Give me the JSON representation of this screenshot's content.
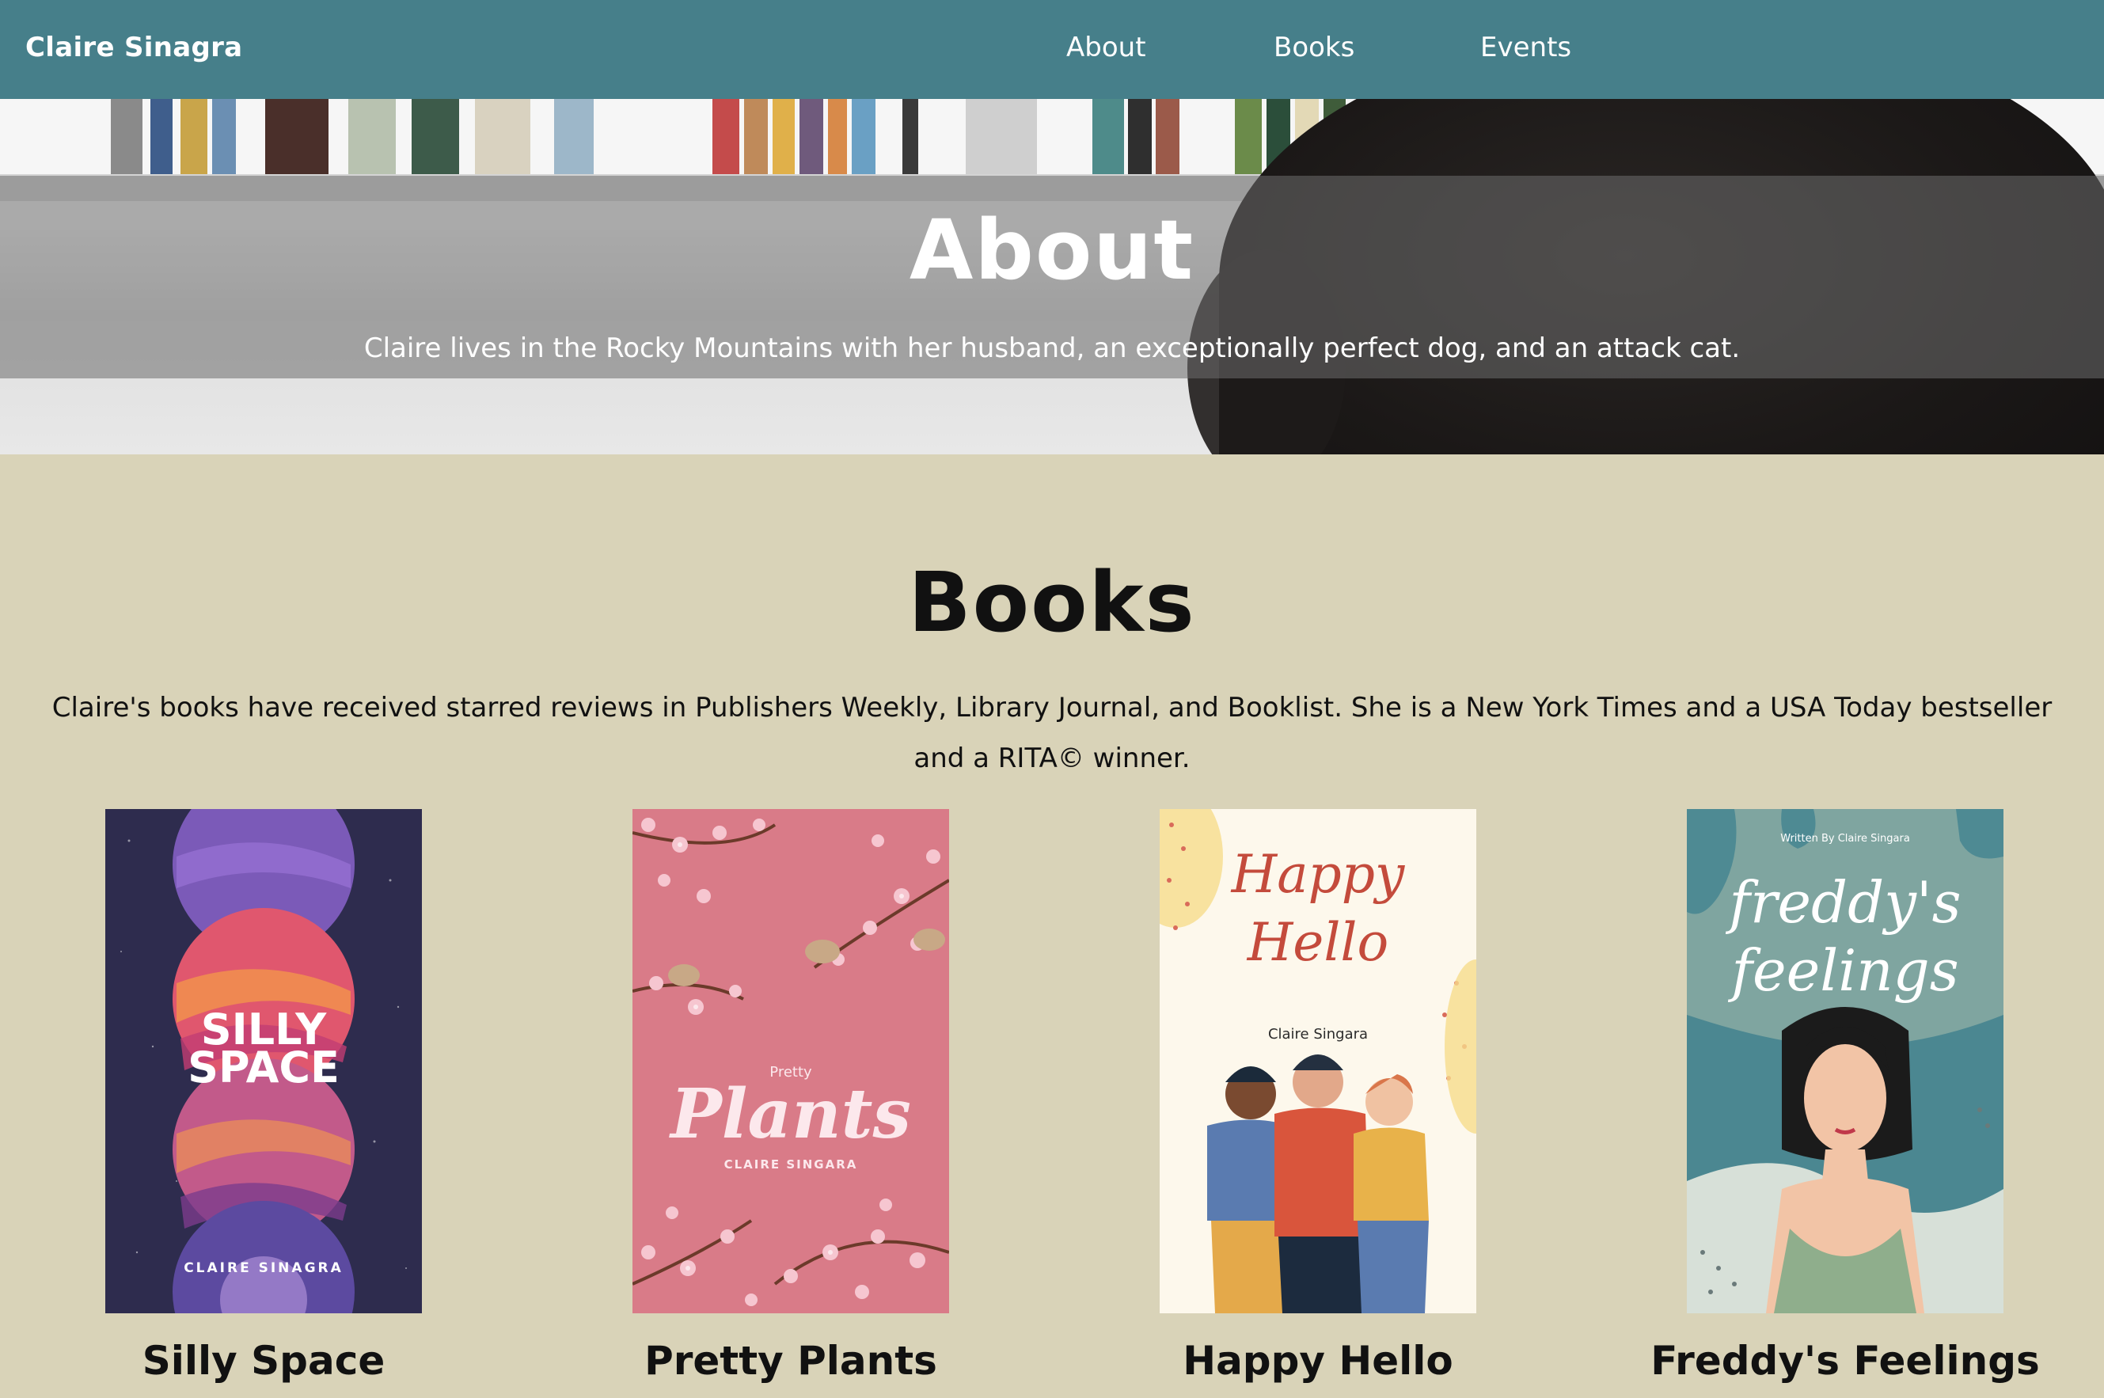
{
  "nav": {
    "brand": "Claire Sinagra",
    "links": [
      "About",
      "Books",
      "Events"
    ],
    "bg": "#467f8a"
  },
  "about": {
    "heading": "About",
    "text": "Claire lives in the Rocky Mountains with her husband, an exceptionally perfect dog, and an attack cat."
  },
  "books": {
    "heading": "Books",
    "intro": "Claire's books have received starred reviews in Publishers Weekly, Library Journal, and Booklist. She is a New York Times and a USA Today bestseller and a RITA© winner.",
    "bg": "#d9d3b8",
    "items": [
      {
        "title": "Silly Space",
        "cover_title_1": "SILLY",
        "cover_title_2": "SPACE",
        "cover_author": "CLAIRE SINAGRA",
        "cover_bg": "#2e2c4e"
      },
      {
        "title": "Pretty Plants",
        "cover_small": "Pretty",
        "cover_title": "Plants",
        "cover_author": "CLAIRE SINGARA",
        "cover_bg": "#d97b88"
      },
      {
        "title": "Happy Hello",
        "cover_title_1": "Happy",
        "cover_title_2": "Hello",
        "cover_author": "Claire Singara",
        "cover_bg": "#fdf8ec"
      },
      {
        "title": "Freddy's Feelings",
        "cover_top": "Written By Claire Singara",
        "cover_title_1": "freddy's",
        "cover_title_2": "feelings",
        "cover_bg": "#7fa5a0"
      }
    ]
  }
}
